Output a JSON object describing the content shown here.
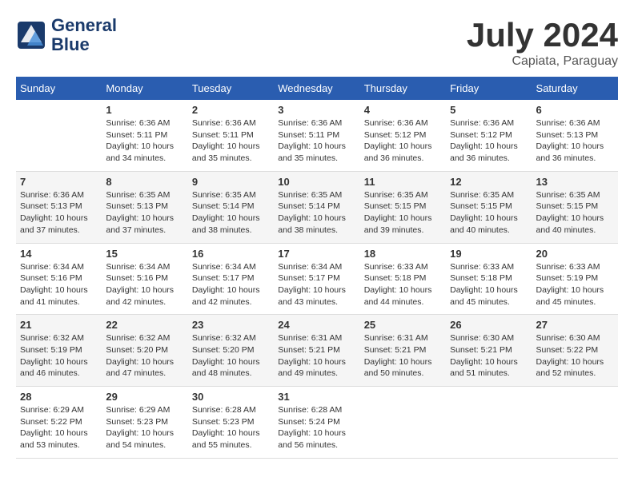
{
  "logo": {
    "name": "General",
    "name2": "Blue"
  },
  "title": "July 2024",
  "location": "Capiata, Paraguay",
  "days_of_week": [
    "Sunday",
    "Monday",
    "Tuesday",
    "Wednesday",
    "Thursday",
    "Friday",
    "Saturday"
  ],
  "weeks": [
    [
      {
        "day": "",
        "info": ""
      },
      {
        "day": "1",
        "info": "Sunrise: 6:36 AM\nSunset: 5:11 PM\nDaylight: 10 hours\nand 34 minutes."
      },
      {
        "day": "2",
        "info": "Sunrise: 6:36 AM\nSunset: 5:11 PM\nDaylight: 10 hours\nand 35 minutes."
      },
      {
        "day": "3",
        "info": "Sunrise: 6:36 AM\nSunset: 5:11 PM\nDaylight: 10 hours\nand 35 minutes."
      },
      {
        "day": "4",
        "info": "Sunrise: 6:36 AM\nSunset: 5:12 PM\nDaylight: 10 hours\nand 36 minutes."
      },
      {
        "day": "5",
        "info": "Sunrise: 6:36 AM\nSunset: 5:12 PM\nDaylight: 10 hours\nand 36 minutes."
      },
      {
        "day": "6",
        "info": "Sunrise: 6:36 AM\nSunset: 5:13 PM\nDaylight: 10 hours\nand 36 minutes."
      }
    ],
    [
      {
        "day": "7",
        "info": "Sunrise: 6:36 AM\nSunset: 5:13 PM\nDaylight: 10 hours\nand 37 minutes."
      },
      {
        "day": "8",
        "info": "Sunrise: 6:35 AM\nSunset: 5:13 PM\nDaylight: 10 hours\nand 37 minutes."
      },
      {
        "day": "9",
        "info": "Sunrise: 6:35 AM\nSunset: 5:14 PM\nDaylight: 10 hours\nand 38 minutes."
      },
      {
        "day": "10",
        "info": "Sunrise: 6:35 AM\nSunset: 5:14 PM\nDaylight: 10 hours\nand 38 minutes."
      },
      {
        "day": "11",
        "info": "Sunrise: 6:35 AM\nSunset: 5:15 PM\nDaylight: 10 hours\nand 39 minutes."
      },
      {
        "day": "12",
        "info": "Sunrise: 6:35 AM\nSunset: 5:15 PM\nDaylight: 10 hours\nand 40 minutes."
      },
      {
        "day": "13",
        "info": "Sunrise: 6:35 AM\nSunset: 5:15 PM\nDaylight: 10 hours\nand 40 minutes."
      }
    ],
    [
      {
        "day": "14",
        "info": "Sunrise: 6:34 AM\nSunset: 5:16 PM\nDaylight: 10 hours\nand 41 minutes."
      },
      {
        "day": "15",
        "info": "Sunrise: 6:34 AM\nSunset: 5:16 PM\nDaylight: 10 hours\nand 42 minutes."
      },
      {
        "day": "16",
        "info": "Sunrise: 6:34 AM\nSunset: 5:17 PM\nDaylight: 10 hours\nand 42 minutes."
      },
      {
        "day": "17",
        "info": "Sunrise: 6:34 AM\nSunset: 5:17 PM\nDaylight: 10 hours\nand 43 minutes."
      },
      {
        "day": "18",
        "info": "Sunrise: 6:33 AM\nSunset: 5:18 PM\nDaylight: 10 hours\nand 44 minutes."
      },
      {
        "day": "19",
        "info": "Sunrise: 6:33 AM\nSunset: 5:18 PM\nDaylight: 10 hours\nand 45 minutes."
      },
      {
        "day": "20",
        "info": "Sunrise: 6:33 AM\nSunset: 5:19 PM\nDaylight: 10 hours\nand 45 minutes."
      }
    ],
    [
      {
        "day": "21",
        "info": "Sunrise: 6:32 AM\nSunset: 5:19 PM\nDaylight: 10 hours\nand 46 minutes."
      },
      {
        "day": "22",
        "info": "Sunrise: 6:32 AM\nSunset: 5:20 PM\nDaylight: 10 hours\nand 47 minutes."
      },
      {
        "day": "23",
        "info": "Sunrise: 6:32 AM\nSunset: 5:20 PM\nDaylight: 10 hours\nand 48 minutes."
      },
      {
        "day": "24",
        "info": "Sunrise: 6:31 AM\nSunset: 5:21 PM\nDaylight: 10 hours\nand 49 minutes."
      },
      {
        "day": "25",
        "info": "Sunrise: 6:31 AM\nSunset: 5:21 PM\nDaylight: 10 hours\nand 50 minutes."
      },
      {
        "day": "26",
        "info": "Sunrise: 6:30 AM\nSunset: 5:21 PM\nDaylight: 10 hours\nand 51 minutes."
      },
      {
        "day": "27",
        "info": "Sunrise: 6:30 AM\nSunset: 5:22 PM\nDaylight: 10 hours\nand 52 minutes."
      }
    ],
    [
      {
        "day": "28",
        "info": "Sunrise: 6:29 AM\nSunset: 5:22 PM\nDaylight: 10 hours\nand 53 minutes."
      },
      {
        "day": "29",
        "info": "Sunrise: 6:29 AM\nSunset: 5:23 PM\nDaylight: 10 hours\nand 54 minutes."
      },
      {
        "day": "30",
        "info": "Sunrise: 6:28 AM\nSunset: 5:23 PM\nDaylight: 10 hours\nand 55 minutes."
      },
      {
        "day": "31",
        "info": "Sunrise: 6:28 AM\nSunset: 5:24 PM\nDaylight: 10 hours\nand 56 minutes."
      },
      {
        "day": "",
        "info": ""
      },
      {
        "day": "",
        "info": ""
      },
      {
        "day": "",
        "info": ""
      }
    ]
  ]
}
